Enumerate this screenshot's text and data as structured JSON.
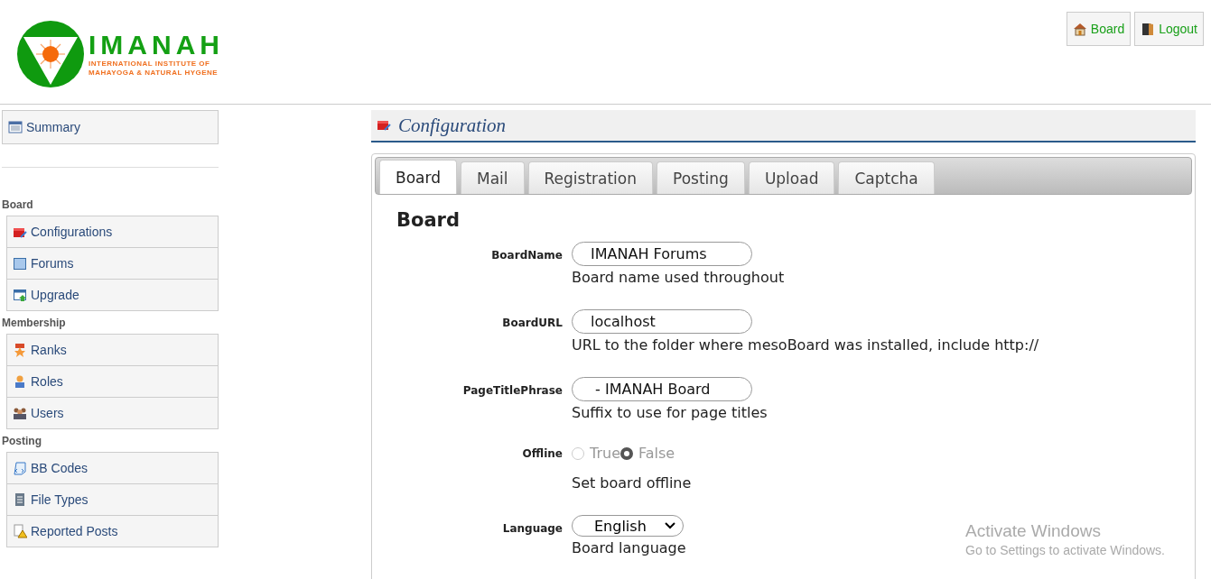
{
  "logo": {
    "name": "IMANAH",
    "tagline_1": "INTERNATIONAL INSTITUTE OF",
    "tagline_2": "MAHAYOGA & NATURAL HYGENE"
  },
  "header_buttons": [
    {
      "label": "Board",
      "kind": "home"
    },
    {
      "label": "Logout",
      "kind": "door"
    }
  ],
  "sidebar": {
    "top_item": {
      "label": "Summary"
    },
    "groups": [
      {
        "heading": "Board",
        "items": [
          {
            "label": "Configurations",
            "kind": "toolbox"
          },
          {
            "label": "Forums",
            "kind": "window"
          },
          {
            "label": "Upgrade",
            "kind": "upgrade"
          }
        ]
      },
      {
        "heading": "Membership",
        "items": [
          {
            "label": "Ranks",
            "kind": "ribbon"
          },
          {
            "label": "Roles",
            "kind": "person"
          },
          {
            "label": "Users",
            "kind": "people"
          }
        ]
      },
      {
        "heading": "Posting",
        "items": [
          {
            "label": "BB Codes",
            "kind": "scroll"
          },
          {
            "label": "File Types",
            "kind": "document"
          },
          {
            "label": "Reported Posts",
            "kind": "warning"
          }
        ]
      }
    ]
  },
  "page_title": "Configuration",
  "tabs": [
    {
      "label": "Board",
      "selected": true
    },
    {
      "label": "Mail",
      "selected": false
    },
    {
      "label": "Registration",
      "selected": false
    },
    {
      "label": "Posting",
      "selected": false
    },
    {
      "label": "Upload",
      "selected": false
    },
    {
      "label": "Captcha",
      "selected": false
    }
  ],
  "section_heading": "Board",
  "fields": [
    {
      "kind": "text",
      "label": "BoardName",
      "value": "IMANAH Forums",
      "help": "Board name used throughout"
    },
    {
      "kind": "text",
      "label": "BoardURL",
      "value": "localhost",
      "help": "URL to the folder where mesoBoard was installed, include http://"
    },
    {
      "kind": "text",
      "label": "PageTitlePhrase",
      "value": " - IMANAH Board",
      "help": "Suffix to use for page titles"
    },
    {
      "kind": "radio",
      "label": "Offline",
      "options": [
        {
          "label": "True",
          "selected": false
        },
        {
          "label": "False",
          "selected": true
        }
      ],
      "disabled": true,
      "help": "Set board offline"
    },
    {
      "kind": "select",
      "label": "Language",
      "value": "English",
      "help": "Board language"
    }
  ],
  "os_notice": {
    "title": "Activate Windows",
    "subtitle": "Go to Settings to activate Windows."
  }
}
